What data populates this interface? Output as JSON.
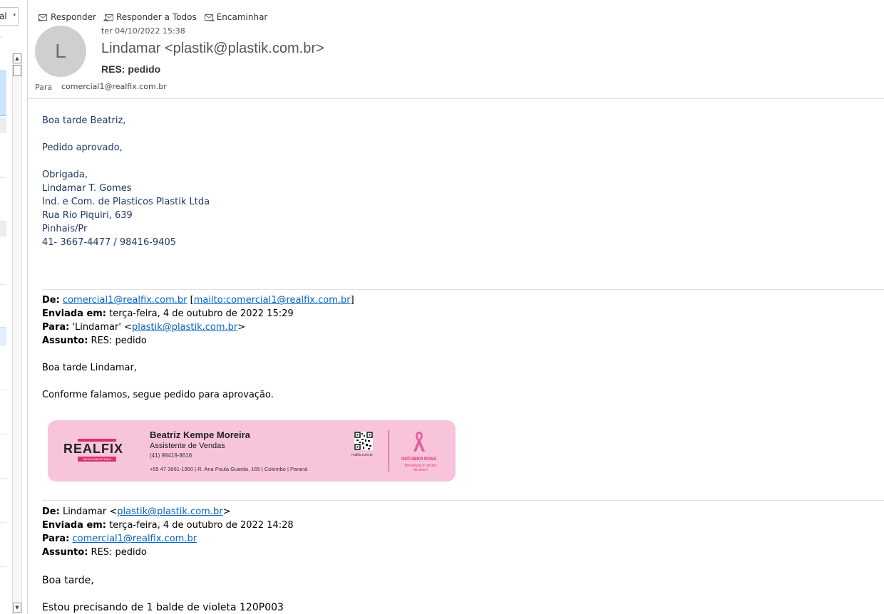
{
  "left_pane": {
    "dropdown_text": "al",
    "dropdown_arrow": "▾",
    "dot": "·"
  },
  "toolbar": {
    "reply_label": "Responder",
    "reply_all_label": "Responder a Todos",
    "forward_label": "Encaminhar",
    "icons": [
      "reply-icon",
      "reply-all-icon",
      "forward-icon"
    ]
  },
  "message": {
    "avatar_initial": "L",
    "date": "ter 04/10/2022 15:38",
    "sender": "Lindamar <plastik@plastik.com.br>",
    "subject": "RES: pedido",
    "to_label": "Para",
    "to_value": "comercial1@realfix.com.br"
  },
  "body": {
    "greeting": "Boa tarde Beatriz,",
    "approved": "Pedido aprovado,",
    "signature": [
      "Obrigada,",
      "Lindamar T. Gomes",
      "Ind. e Com. de Plasticos Plastik Ltda",
      "Rua Rio Piquiri, 639",
      "Pinhais/Pr",
      "41- 3667-4477 / 98416-9405"
    ]
  },
  "quoted1": {
    "from_label": "De:",
    "from_link": "comercial1@realfix.com.br",
    "from_mailto": "[mailto:comercial1@realfix.com.br]",
    "mailto_open": "[",
    "mailto_link": "mailto:comercial1@realfix.com.br",
    "mailto_close": "]",
    "sent_label": "Enviada em:",
    "sent_value": "terça-feira, 4 de outubro de 2022 15:29",
    "to_label": "Para:",
    "to_prefix": "'Lindamar' <",
    "to_link": "plastik@plastik.com.br",
    "to_suffix": ">",
    "subject_label": "Assunto:",
    "subject_value": "RES: pedido",
    "greeting": "Boa tarde Lindamar,",
    "text": "Conforme falamos, segue pedido para aprovação."
  },
  "email_signature_banner": {
    "logo_text": "REALFIX",
    "logo_tagline": "TINTAS INDUSTRIAIS",
    "name": "Beatriz Kempe Moreira",
    "role": "Assistente de Vendas",
    "phone": "(41) 98419-8616",
    "address": "+55 47 3661-1850 | R. Ana Paula Guarda, 165 | Colombo | Paraná",
    "website": "realfix.com.br",
    "campaign": "OUTUBRO ROSA",
    "slogan": "Prevenção é um ato de amor!",
    "accent_color": "#d6336c",
    "background_color": "#f8c4dc"
  },
  "quoted2": {
    "from_label": "De:",
    "from_prefix": "Lindamar <",
    "from_link": "plastik@plastik.com.br",
    "from_suffix": ">",
    "sent_label": "Enviada em:",
    "sent_value": "terça-feira, 4 de outubro de 2022 14:28",
    "to_label": "Para:",
    "to_link": "comercial1@realfix.com.br",
    "subject_label": "Assunto:",
    "subject_value": "RES: pedido",
    "greeting": "Boa tarde,",
    "text_partial": "Estou precisando de 1 balde de violeta 120P003"
  },
  "colors": {
    "body_text_navy": "#1f3864",
    "link_blue": "#0563c1",
    "avatar_grey": "#cfcfcf"
  }
}
